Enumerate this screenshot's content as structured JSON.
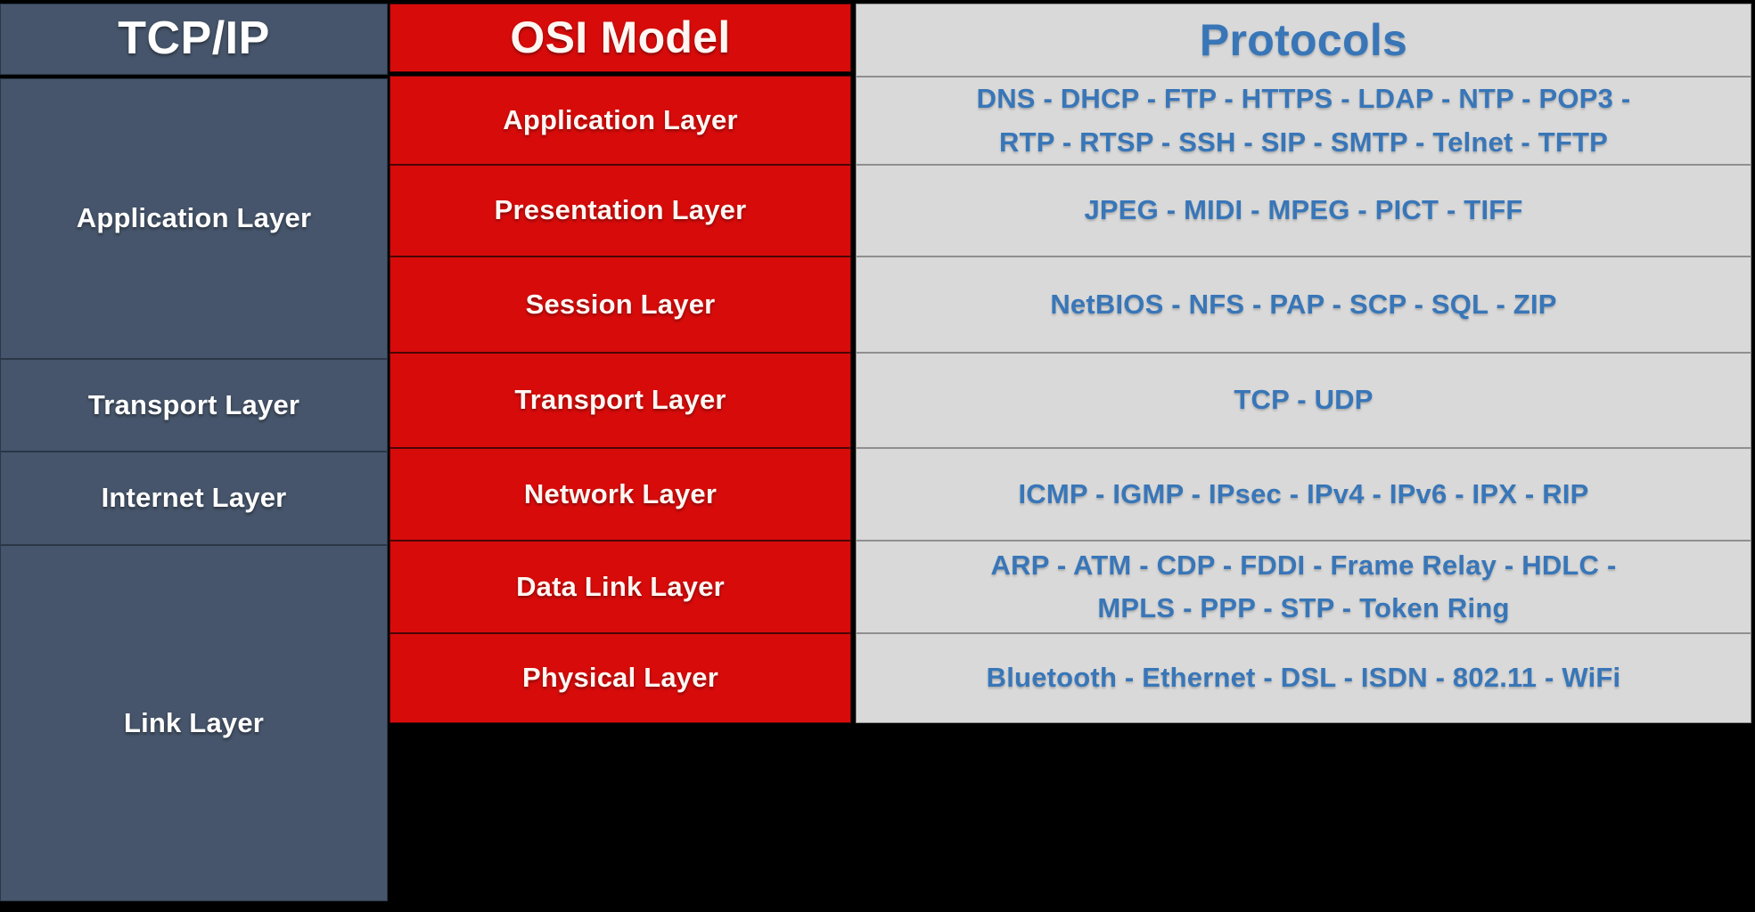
{
  "headers": {
    "tcpip": "TCP/IP",
    "osi": "OSI Model",
    "protocols": "Protocols"
  },
  "colors": {
    "tcpip_bg": "#46556B",
    "osi_bg": "#D80B0B",
    "protocols_bg": "#D9D9D9",
    "protocols_text": "#3876B8",
    "header_text": "#FFFFFF",
    "page_bg": "#000000"
  },
  "tcpip_layers": [
    {
      "label": "Application Layer",
      "spans": 3
    },
    {
      "label": "Transport Layer",
      "spans": 1
    },
    {
      "label": "Internet Layer",
      "spans": 1
    },
    {
      "label": "Link Layer",
      "spans": 2
    }
  ],
  "osi_layers": [
    {
      "label": "Application Layer"
    },
    {
      "label": "Presentation Layer"
    },
    {
      "label": "Session Layer"
    },
    {
      "label": "Transport Layer"
    },
    {
      "label": "Network Layer"
    },
    {
      "label": "Data Link Layer"
    },
    {
      "label": "Physical Layer"
    }
  ],
  "protocols": [
    {
      "layer": "Application Layer",
      "line1": "DNS - DHCP - FTP - HTTPS - LDAP - NTP - POP3 -",
      "line2": "RTP - RTSP - SSH - SIP - SMTP - Telnet - TFTP",
      "list": [
        "DNS",
        "DHCP",
        "FTP",
        "HTTPS",
        "LDAP",
        "NTP",
        "POP3",
        "RTP",
        "RTSP",
        "SSH",
        "SIP",
        "SMTP",
        "Telnet",
        "TFTP"
      ]
    },
    {
      "layer": "Presentation Layer",
      "line1": "JPEG - MIDI - MPEG - PICT - TIFF",
      "line2": "",
      "list": [
        "JPEG",
        "MIDI",
        "MPEG",
        "PICT",
        "TIFF"
      ]
    },
    {
      "layer": "Session Layer",
      "line1": "NetBIOS - NFS - PAP - SCP - SQL - ZIP",
      "line2": "",
      "list": [
        "NetBIOS",
        "NFS",
        "PAP",
        "SCP",
        "SQL",
        "ZIP"
      ]
    },
    {
      "layer": "Transport Layer",
      "line1": "TCP - UDP",
      "line2": "",
      "list": [
        "TCP",
        "UDP"
      ]
    },
    {
      "layer": "Network Layer",
      "line1": "ICMP - IGMP - IPsec - IPv4 - IPv6 - IPX - RIP",
      "line2": "",
      "list": [
        "ICMP",
        "IGMP",
        "IPsec",
        "IPv4",
        "IPv6",
        "IPX",
        "RIP"
      ]
    },
    {
      "layer": "Data Link Layer",
      "line1": "ARP - ATM - CDP - FDDI - Frame Relay - HDLC -",
      "line2": "MPLS - PPP  - STP - Token Ring",
      "list": [
        "ARP",
        "ATM",
        "CDP",
        "FDDI",
        "Frame Relay",
        "HDLC",
        "MPLS",
        "PPP",
        "STP",
        "Token Ring"
      ]
    },
    {
      "layer": "Physical Layer",
      "line1": "Bluetooth - Ethernet - DSL - ISDN - 802.11 - WiFi",
      "line2": "",
      "list": [
        "Bluetooth",
        "Ethernet",
        "DSL",
        "ISDN",
        "802.11",
        "WiFi"
      ]
    }
  ]
}
